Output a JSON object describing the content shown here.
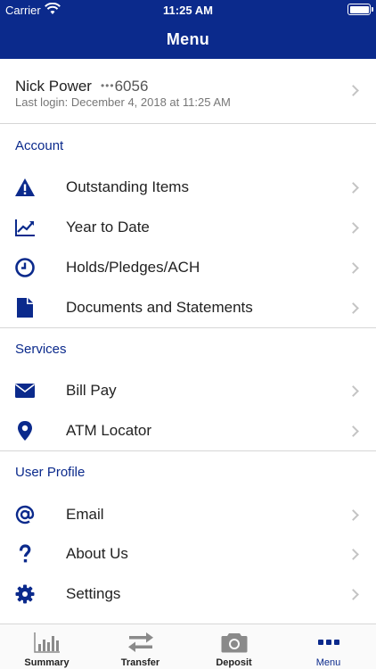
{
  "status_bar": {
    "carrier": "Carrier",
    "time": "11:25 AM"
  },
  "header": {
    "title": "Menu"
  },
  "account_summary": {
    "name": "Nick Power",
    "masked": "•••",
    "account_suffix": "6056",
    "last_login": "Last login: December 4, 2018 at 11:25 AM"
  },
  "sections": {
    "account": {
      "title": "Account",
      "items": [
        {
          "label": "Outstanding Items",
          "icon": "warning-icon"
        },
        {
          "label": "Year to Date",
          "icon": "trend-chart-icon"
        },
        {
          "label": "Holds/Pledges/ACH",
          "icon": "clock-icon"
        },
        {
          "label": "Documents and Statements",
          "icon": "document-icon"
        }
      ]
    },
    "services": {
      "title": "Services",
      "items": [
        {
          "label": "Bill Pay",
          "icon": "envelope-icon"
        },
        {
          "label": "ATM Locator",
          "icon": "map-pin-icon"
        }
      ]
    },
    "user_profile": {
      "title": "User Profile",
      "items": [
        {
          "label": "Email",
          "icon": "at-sign-icon"
        },
        {
          "label": "About Us",
          "icon": "question-icon"
        },
        {
          "label": "Settings",
          "icon": "gear-icon"
        }
      ]
    }
  },
  "tabbar": {
    "tabs": [
      {
        "label": "Summary",
        "icon": "bar-chart-icon"
      },
      {
        "label": "Transfer",
        "icon": "transfer-arrows-icon"
      },
      {
        "label": "Deposit",
        "icon": "camera-icon"
      },
      {
        "label": "Menu",
        "icon": "more-dots-icon",
        "active": true
      }
    ]
  },
  "colors": {
    "brand": "#0b2a8c",
    "icon": "#0b2a8c",
    "tab_icon_inactive": "#8a8a8a",
    "chevron": "#c4c4c4"
  }
}
